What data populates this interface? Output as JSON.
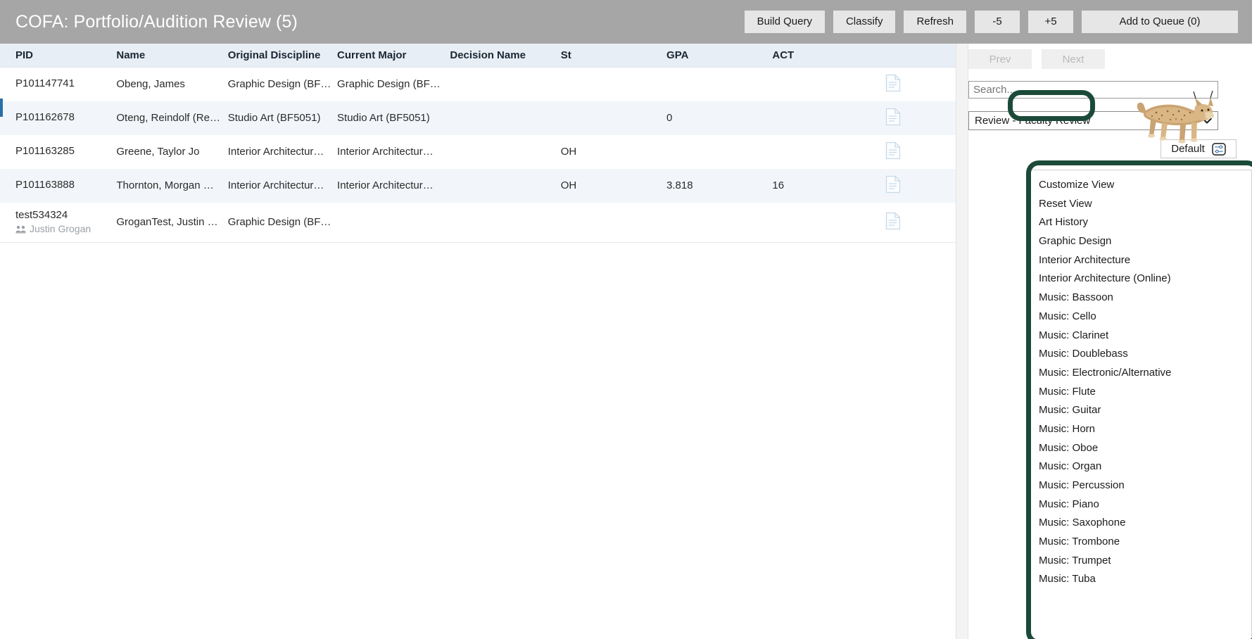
{
  "header": {
    "title": "COFA: Portfolio/Audition Review (5)",
    "buttons": [
      {
        "label": "Build Query",
        "name": "build-query-button"
      },
      {
        "label": "Classify",
        "name": "classify-button"
      },
      {
        "label": "Refresh",
        "name": "refresh-button"
      },
      {
        "label": "-5",
        "name": "minus-five-button"
      },
      {
        "label": "+5",
        "name": "plus-five-button"
      },
      {
        "label": "Add to Queue (0)",
        "name": "add-to-queue-button"
      }
    ]
  },
  "grid": {
    "columns": [
      "PID",
      "Name",
      "Original Discipline",
      "Current Major",
      "Decision Name",
      "St",
      "GPA",
      "ACT",
      ""
    ],
    "rows": [
      {
        "pid": "P101147741",
        "sub": "",
        "name": "Obeng, James",
        "original_discipline": "Graphic Design (BF…",
        "current_major": "Graphic Design (BF…",
        "decision_name": "",
        "st": "",
        "gpa": "",
        "act": "",
        "doc_icon": "document-icon"
      },
      {
        "pid": "P101162678",
        "sub": "",
        "name": "Oteng, Reindolf (Re…",
        "original_discipline": "Studio Art (BF5051)",
        "current_major": "Studio Art (BF5051)",
        "decision_name": "",
        "st": "",
        "gpa": "0",
        "act": "",
        "doc_icon": "document-icon"
      },
      {
        "pid": "P101163285",
        "sub": "",
        "name": "Greene, Taylor Jo",
        "original_discipline": "Interior Architectur…",
        "current_major": "Interior Architectur…",
        "decision_name": "",
        "st": "OH",
        "gpa": "",
        "act": "",
        "doc_icon": "document-icon"
      },
      {
        "pid": "P101163888",
        "sub": "",
        "name": "Thornton, Morgan …",
        "original_discipline": "Interior Architectur…",
        "current_major": "Interior Architectur…",
        "decision_name": "",
        "st": "OH",
        "gpa": "3.818",
        "act": "16",
        "doc_icon": "document-icon"
      },
      {
        "pid": "test534324",
        "sub": "Justin Grogan",
        "name": "GroganTest, Justin …",
        "original_discipline": "Graphic Design (BF…",
        "current_major": "",
        "decision_name": "",
        "st": "",
        "gpa": "",
        "act": "",
        "doc_icon": "document-icon"
      }
    ]
  },
  "side": {
    "prev_label": "Prev",
    "next_label": "Next",
    "search_placeholder": "Search...",
    "review_select_value": "Review - Faculty Review",
    "default_button_label": "Default",
    "menu_items": [
      "Customize View",
      "Reset View",
      "Art History",
      "Graphic Design",
      "Interior Architecture",
      "Interior Architecture (Online)",
      "Music: Bassoon",
      "Music: Cello",
      "Music: Clarinet",
      "Music: Doublebass",
      "Music: Electronic/Alternative",
      "Music: Flute",
      "Music: Guitar",
      "Music: Horn",
      "Music: Oboe",
      "Music: Organ",
      "Music: Percussion",
      "Music: Piano",
      "Music: Saxophone",
      "Music: Trombone",
      "Music: Trumpet",
      "Music: Tuba"
    ]
  },
  "colors": {
    "header_bg": "#a6a6a6",
    "grid_header_bg": "#e8eef5",
    "row_alt_bg": "#f2f6fa",
    "annotation": "#1c4a39",
    "row_accent": "#2a6fa8"
  }
}
